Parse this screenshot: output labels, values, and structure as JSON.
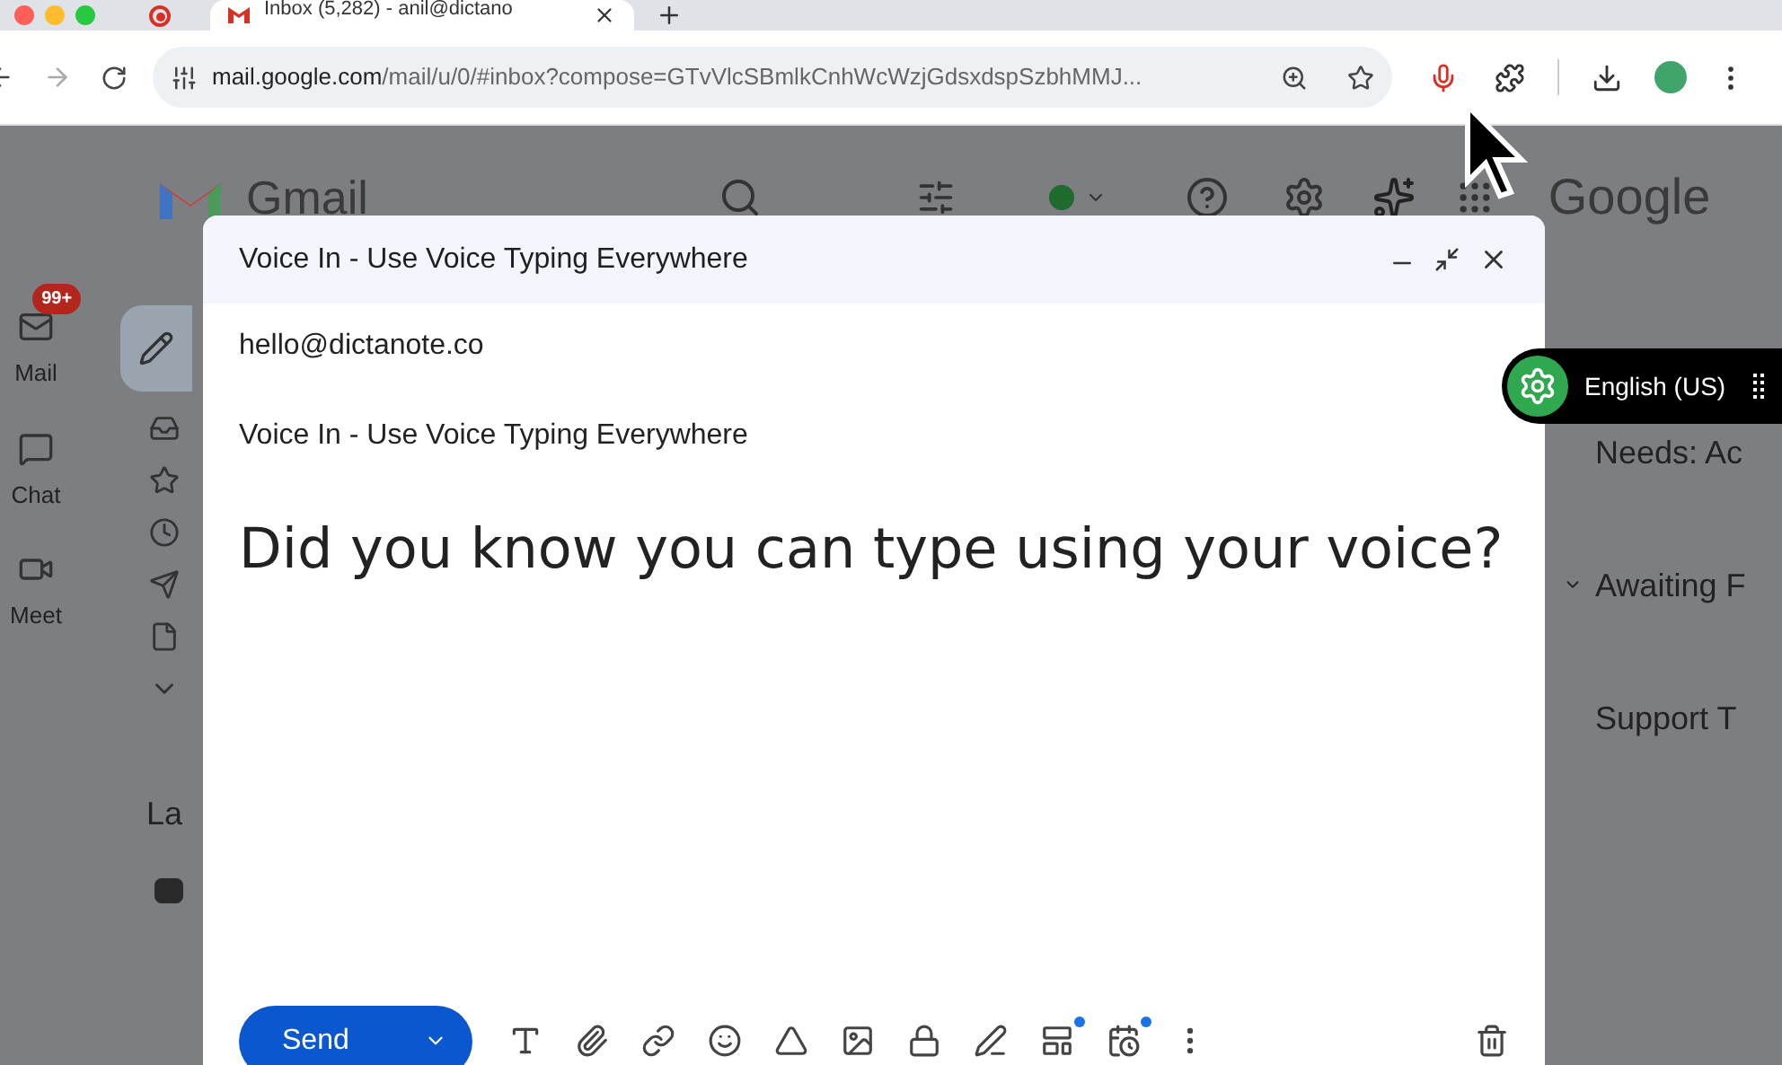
{
  "browser": {
    "tab": {
      "title": "Inbox (5,282) - anil@dictano",
      "selected": true
    },
    "address": {
      "host": "mail.google.com",
      "path": "/mail/u/0/#inbox?compose=GTvVlcSBmlkCnhWcWzjGdsxdspSzbhMMJ..."
    },
    "mic_active": true
  },
  "gmail": {
    "brand": "Gmail",
    "google": "Google",
    "rail": [
      {
        "kind": "mail",
        "label": "Mail",
        "badge": "99+"
      },
      {
        "kind": "chat",
        "label": "Chat"
      },
      {
        "kind": "meet",
        "label": "Meet"
      }
    ],
    "labels_heading": "La",
    "right_items": [
      {
        "label": "Needs: Ac",
        "chevron": false
      },
      {
        "label": "Awaiting F",
        "chevron": true
      },
      {
        "label": "Support T",
        "chevron": false
      }
    ]
  },
  "compose": {
    "title": "Voice In - Use Voice Typing Everywhere",
    "to": "hello@dictanote.co",
    "subject": "Voice In - Use Voice Typing Everywhere",
    "body": "Did you know you can type using your voice?",
    "send": "Send"
  },
  "voice_widget": {
    "language": "English (US)"
  }
}
